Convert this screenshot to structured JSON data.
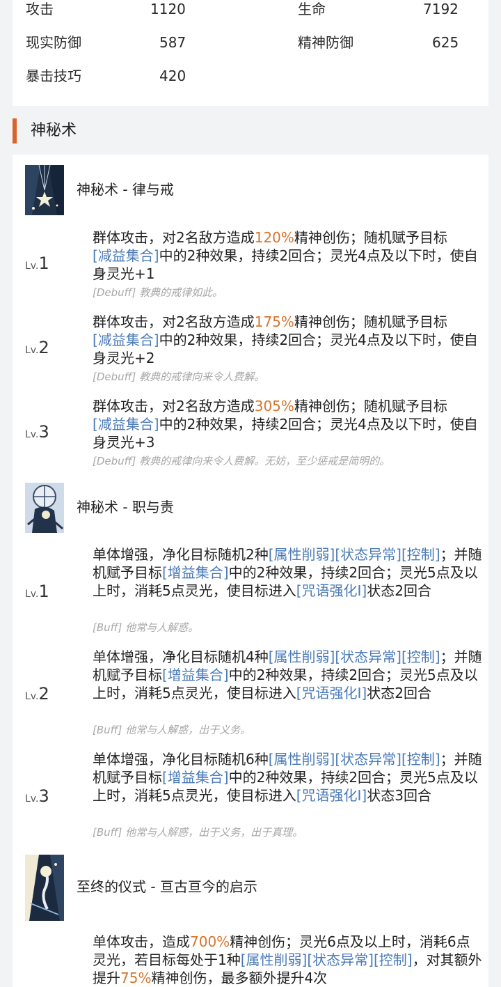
{
  "stats": {
    "atk_label": "攻击",
    "atk_value": "1120",
    "hp_label": "生命",
    "hp_value": "7192",
    "rdef_label": "现实防御",
    "rdef_value": "587",
    "mdef_label": "精神防御",
    "mdef_value": "625",
    "crit_label": "暴击技巧",
    "crit_value": "420"
  },
  "section": {
    "title": "神秘术",
    "accent_color": "#d8642c"
  },
  "colors": {
    "highlight": "#d8742c",
    "tag": "#4a7ab8",
    "flavor": "#a7a7a7"
  },
  "skills": [
    {
      "name": "神秘术 - 律与戒",
      "icon": "arcane-skill-1-icon",
      "levels": [
        {
          "lv_prefix": "Lv.",
          "lv_num": "1",
          "p1": "群体攻击，对2名敌方造成",
          "hl1": "120%",
          "p2": "精神创伤；随机赋予目标",
          "tag1": "[减益集合]",
          "p3": "中的2种效果，持续2回合；灵光4点及以下时，使自身灵光+1",
          "flavor": "[Debuff] 教典的戒律如此。"
        },
        {
          "lv_prefix": "Lv.",
          "lv_num": "2",
          "p1": "群体攻击，对2名敌方造成",
          "hl1": "175%",
          "p2": "精神创伤；随机赋予目标",
          "tag1": "[减益集合]",
          "p3": "中的2种效果，持续2回合；灵光4点及以下时，使自身灵光+2",
          "flavor": "[Debuff] 教典的戒律向来令人费解。"
        },
        {
          "lv_prefix": "Lv.",
          "lv_num": "3",
          "p1": "群体攻击，对2名敌方造成",
          "hl1": "305%",
          "p2": "精神创伤；随机赋予目标",
          "tag1": "[减益集合]",
          "p3": "中的2种效果，持续2回合；灵光4点及以下时，使自身灵光+3",
          "flavor": "[Debuff] 教典的戒律向来令人费解。无妨，至少惩戒是简明的。"
        }
      ]
    },
    {
      "name": "神秘术 - 职与责",
      "icon": "arcane-skill-2-icon",
      "levels": [
        {
          "lv_prefix": "Lv.",
          "lv_num": "1",
          "p1": "单体增强，净化目标随机2种",
          "tag1": "[属性削弱]",
          "tag2": "[状态异常]",
          "tag3": "[控制]",
          "p2": "；并随机赋予目标",
          "tag4": "[增益集合]",
          "p3": "中的2种效果，持续2回合；灵光5点及以上时，消耗5点灵光，使目标进入",
          "tag5": "[咒语强化I]",
          "p4": "状态2回合",
          "flavor": "[Buff] 他常与人解惑。"
        },
        {
          "lv_prefix": "Lv.",
          "lv_num": "2",
          "p1": "单体增强，净化目标随机4种",
          "tag1": "[属性削弱]",
          "tag2": "[状态异常]",
          "tag3": "[控制]",
          "p2": "；并随机赋予目标",
          "tag4": "[增益集合]",
          "p3": "中的2种效果，持续2回合；灵光5点及以上时，消耗5点灵光，使目标进入",
          "tag5": "[咒语强化I]",
          "p4": "状态2回合",
          "flavor": "[Buff] 他常与人解惑，出于义务。"
        },
        {
          "lv_prefix": "Lv.",
          "lv_num": "3",
          "p1": "单体增强，净化目标随机6种",
          "tag1": "[属性削弱]",
          "tag2": "[状态异常]",
          "tag3": "[控制]",
          "p2": "；并随机赋予目标",
          "tag4": "[增益集合]",
          "p3": "中的2种效果，持续2回合；灵光5点及以上时，消耗5点灵光，使目标进入",
          "tag5": "[咒语强化I]",
          "p4": "状态3回合",
          "flavor": "[Buff] 他常与人解惑，出于义务，出于真理。"
        }
      ]
    },
    {
      "name": "至终的仪式 - 亘古亘今的启示",
      "icon": "ultimate-skill-icon",
      "desc": {
        "p1": "单体攻击，造成",
        "hl1": "700%",
        "p2": "精神创伤；灵光6点及以上时，消耗6点灵光，若目标每处于1种",
        "tag1": "[属性削弱]",
        "tag2": "[状态异常]",
        "tag3": "[控制]",
        "p3": "，对其额外提升",
        "hl2": "75%",
        "p4": "精神创伤，最多额外提升4次"
      }
    }
  ]
}
